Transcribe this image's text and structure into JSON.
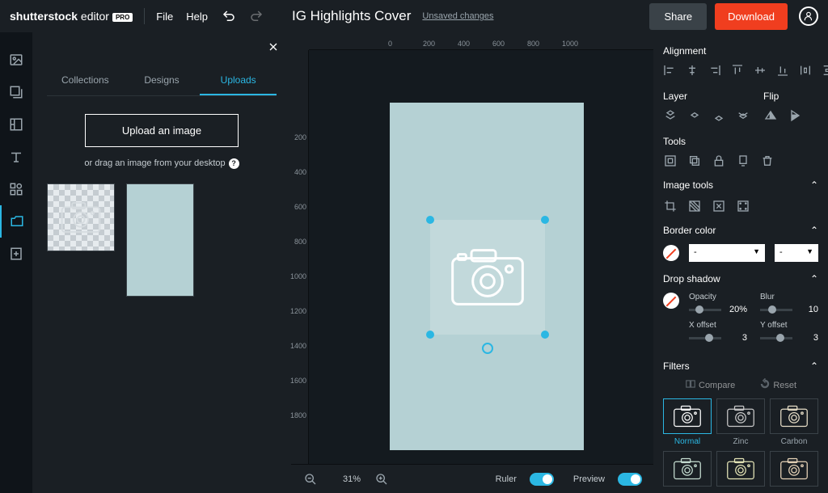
{
  "header": {
    "brand_primary": "shutterstock",
    "brand_secondary": "editor",
    "pro_badge": "PRO",
    "file_menu": "File",
    "help_menu": "Help",
    "document_title": "IG Highlights Cover",
    "unsaved_label": "Unsaved changes",
    "share_label": "Share",
    "download_label": "Download"
  },
  "sidepanel": {
    "tabs": {
      "collections": "Collections",
      "designs": "Designs",
      "uploads": "Uploads"
    },
    "upload_button": "Upload an image",
    "drag_hint": "or drag an image from your desktop"
  },
  "ruler_h": [
    "0",
    "200",
    "400",
    "600",
    "800",
    "1000"
  ],
  "ruler_v": [
    "200",
    "400",
    "600",
    "800",
    "1000",
    "1200",
    "1400",
    "1600",
    "1800"
  ],
  "bottombar": {
    "zoom": "31%",
    "ruler_label": "Ruler",
    "preview_label": "Preview"
  },
  "right": {
    "alignment_title": "Alignment",
    "layer_title": "Layer",
    "flip_title": "Flip",
    "tools_title": "Tools",
    "image_tools_title": "Image tools",
    "border_color_title": "Border color",
    "border_select_placeholder": "-",
    "drop_shadow_title": "Drop shadow",
    "opacity_label": "Opacity",
    "opacity_value": "20%",
    "blur_label": "Blur",
    "blur_value": "10",
    "xoffset_label": "X offset",
    "xoffset_value": "3",
    "yoffset_label": "Y offset",
    "yoffset_value": "3",
    "filters_title": "Filters",
    "compare_label": "Compare",
    "reset_label": "Reset",
    "filters": {
      "normal": "Normal",
      "zinc": "Zinc",
      "carbon": "Carbon"
    }
  }
}
